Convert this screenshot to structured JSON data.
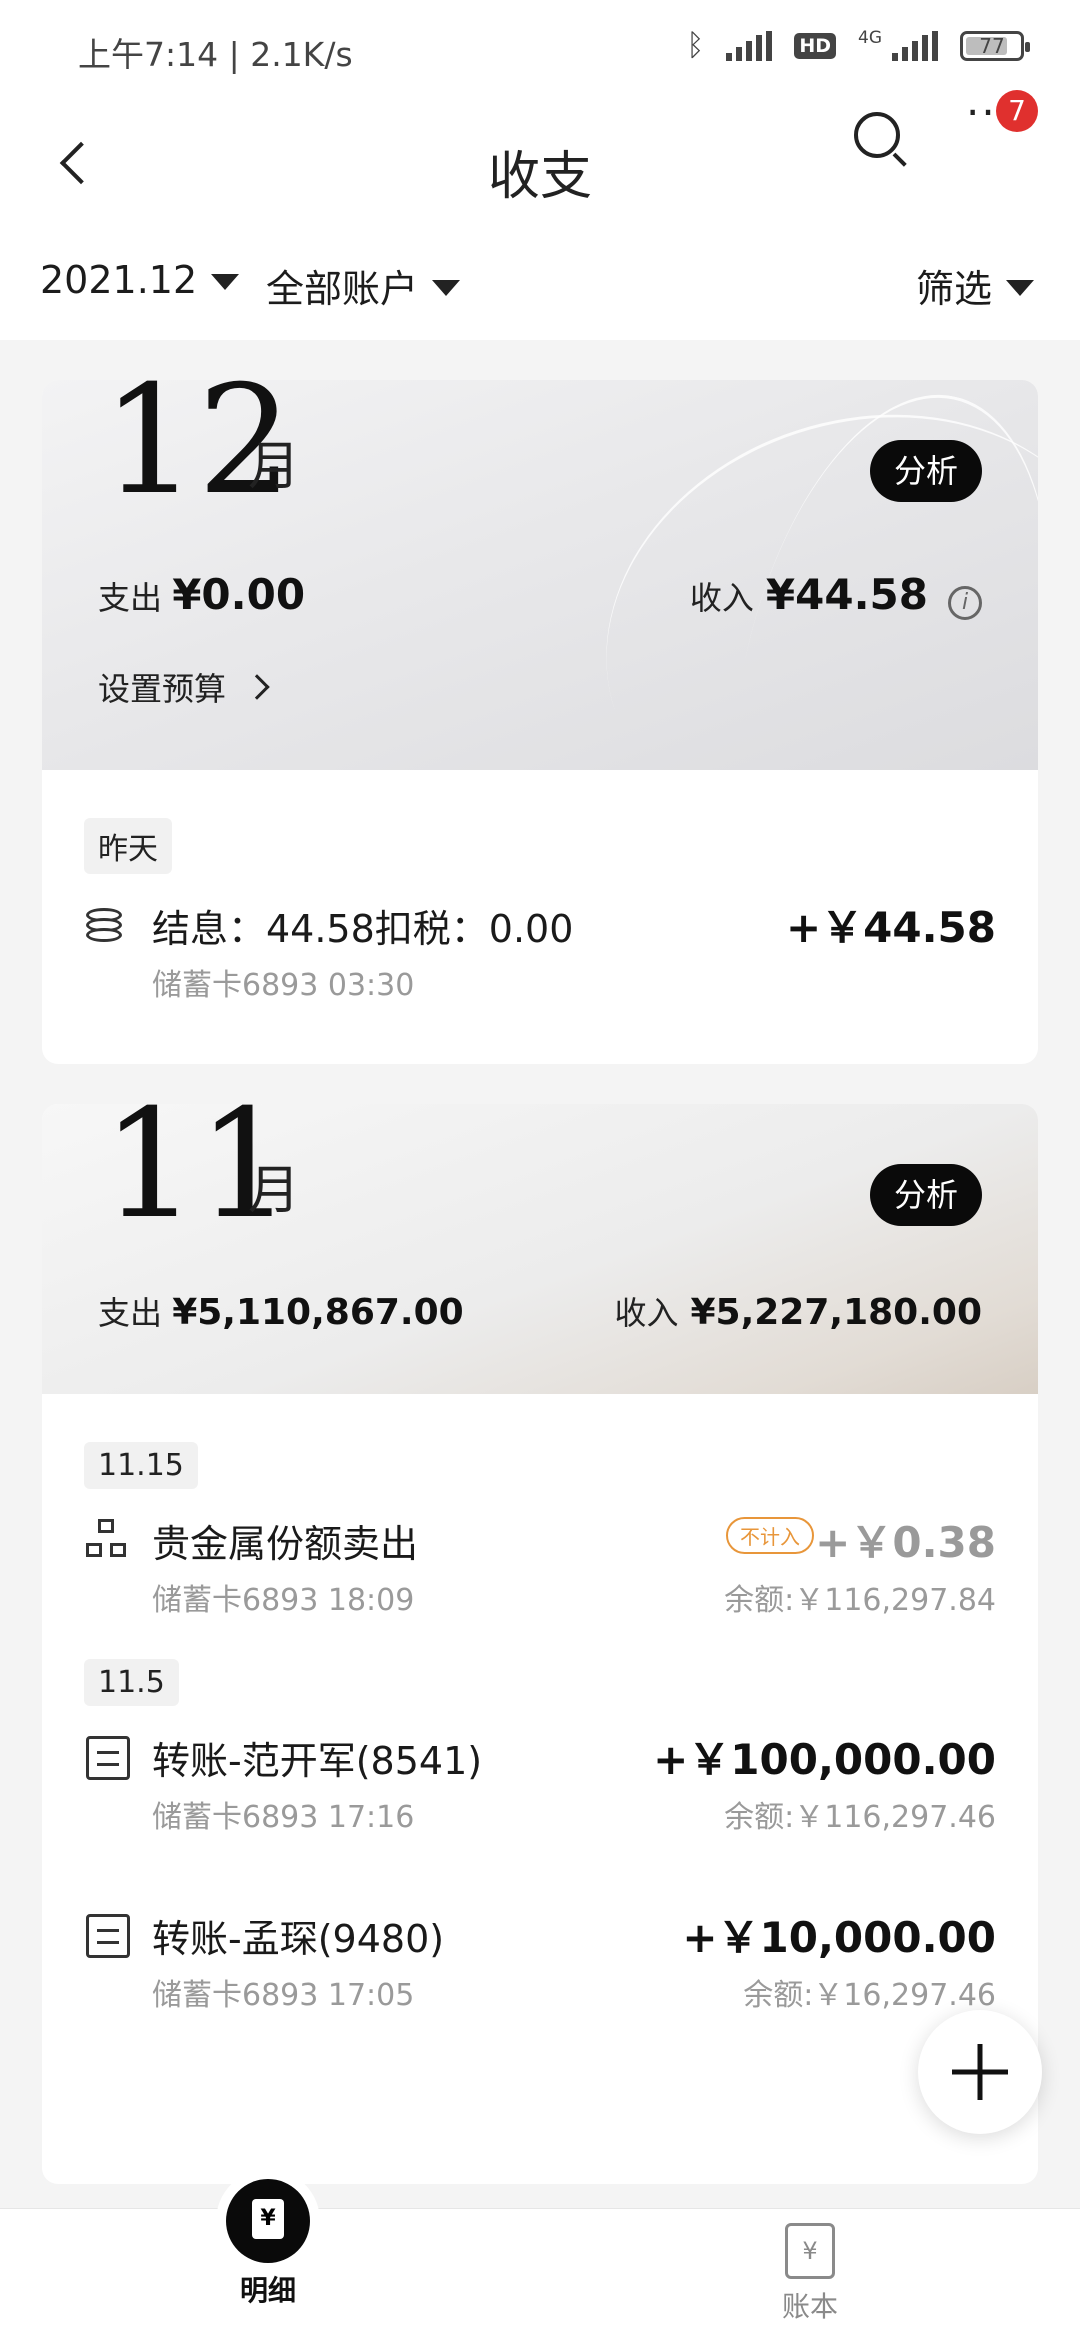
{
  "statusbar": {
    "time_speed": "上午7:14 | 2.1K/s",
    "network": "4G",
    "hd": "HD",
    "battery": "77"
  },
  "header": {
    "title": "收支",
    "notification_count": "7"
  },
  "filters": {
    "month": "2021.12",
    "account": "全部账户",
    "filter": "筛选"
  },
  "months": [
    {
      "month_number": "12",
      "month_unit": "月",
      "analyze_label": "分析",
      "expense_label": "支出",
      "expense_amount": "¥0.00",
      "income_label": "收入",
      "income_amount": "¥44.58",
      "budget_label": "设置预算",
      "groups": [
        {
          "date": "昨天",
          "items": [
            {
              "title": "结息：44.58扣税：0.00",
              "sub": "储蓄卡6893 03:30",
              "amount": "+￥44.58",
              "icon": "coins-icon"
            }
          ]
        }
      ]
    },
    {
      "month_number": "11",
      "month_unit": "月",
      "analyze_label": "分析",
      "expense_label": "支出",
      "expense_amount": "¥5,110,867.00",
      "income_label": "收入",
      "income_amount": "¥5,227,180.00",
      "groups": [
        {
          "date": "11.15",
          "items": [
            {
              "title": "贵金属份额卖出",
              "sub": "储蓄卡6893 18:09",
              "tag": "不计入",
              "amount": "+￥0.38",
              "balance": "余额:￥116,297.84",
              "icon": "hierarchy-icon"
            }
          ]
        },
        {
          "date": "11.5",
          "items": [
            {
              "title": "转账-范开军(8541)",
              "sub": "储蓄卡6893 17:16",
              "amount": "+￥100,000.00",
              "balance": "余额:￥116,297.46",
              "icon": "transfer-icon"
            },
            {
              "title": "转账-孟琛(9480)",
              "sub": "储蓄卡6893 17:05",
              "amount": "+￥10,000.00",
              "balance": "余额:￥16,297.46",
              "icon": "transfer-icon"
            }
          ]
        }
      ]
    }
  ],
  "bottom_nav": {
    "detail_label": "明细",
    "book_label": "账本",
    "icon_glyph": "¥"
  }
}
